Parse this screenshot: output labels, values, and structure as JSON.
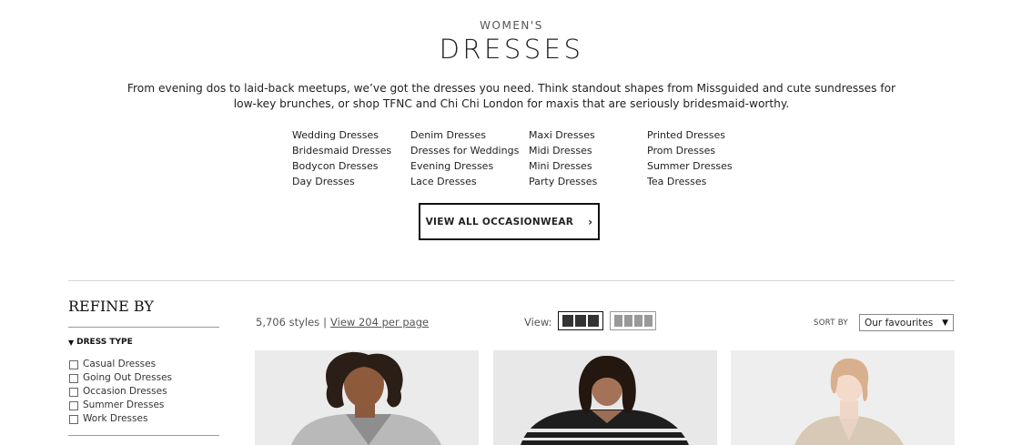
{
  "header": {
    "kicker": "WOMEN'S",
    "title": "DRESSES",
    "description": "From evening dos to laid-back meetups, we’ve got the dresses you need. Think standout shapes from Missguided and cute sundresses for low-key brunches, or shop TFNC and Chi Chi London for maxis that are seriously bridesmaid-worthy."
  },
  "categories": {
    "col1": [
      "Wedding Dresses",
      "Bridesmaid Dresses",
      "Bodycon Dresses",
      "Day Dresses"
    ],
    "col2": [
      "Denim Dresses",
      "Dresses for Weddings",
      "Evening Dresses",
      "Lace Dresses"
    ],
    "col3": [
      "Maxi Dresses",
      "Midi Dresses",
      "Mini Dresses",
      "Party Dresses"
    ],
    "col4": [
      "Printed Dresses",
      "Prom Dresses",
      "Summer Dresses",
      "Tea Dresses"
    ]
  },
  "cta": {
    "label": "VIEW ALL OCCASIONWEAR",
    "chevron": "›"
  },
  "refine": {
    "title": "REFINE BY",
    "filter_group": {
      "label": "DRESS TYPE",
      "options": [
        "Casual Dresses",
        "Going Out Dresses",
        "Occasion Dresses",
        "Summer Dresses",
        "Work Dresses"
      ]
    }
  },
  "toolbar": {
    "count": "5,706 styles",
    "separator": "|",
    "per_page_link": "View 204 per page",
    "view_label": "View:",
    "sort_label": "SORT BY",
    "sort_value": "Our favourites",
    "sort_arrow": "▼"
  },
  "icons": {
    "cta_chevron": "chevron-right-icon",
    "filter_toggle": "triangle-down-icon",
    "view_three": "grid-3-icon",
    "view_four": "grid-4-icon"
  },
  "colors": {
    "text": "#222222",
    "divider": "#d4d4d4",
    "border": "#111111"
  }
}
